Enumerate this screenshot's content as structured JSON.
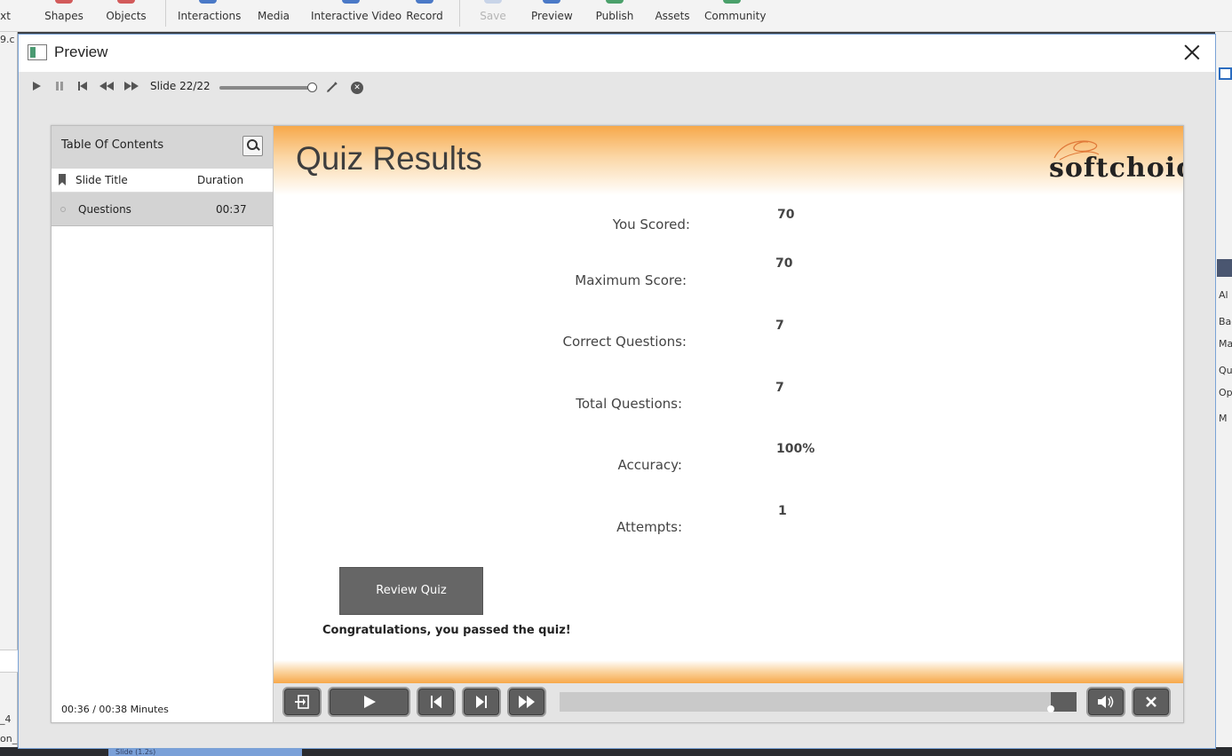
{
  "host_toolbar": {
    "items": [
      {
        "label": "xt",
        "state": "normal"
      },
      {
        "label": "Shapes",
        "state": "normal"
      },
      {
        "label": "Objects",
        "state": "normal"
      },
      {
        "label": "Interactions",
        "state": "normal"
      },
      {
        "label": "Media",
        "state": "normal"
      },
      {
        "label": "Interactive Video",
        "state": "normal"
      },
      {
        "label": "Record",
        "state": "normal"
      },
      {
        "label": "Save",
        "state": "disabled"
      },
      {
        "label": "Preview",
        "state": "normal"
      },
      {
        "label": "Publish",
        "state": "normal"
      },
      {
        "label": "Assets",
        "state": "normal"
      },
      {
        "label": "Community",
        "state": "normal"
      }
    ]
  },
  "host_edges": {
    "left_top": "9.c",
    "left_mid": "_4",
    "left_bottom": "on_",
    "right_labels": [
      "Al",
      "Back",
      "Ma",
      "Qual",
      "Op",
      "M"
    ],
    "bottom_tab": "Slide (1.2s)"
  },
  "dialog": {
    "title": "Preview",
    "controls": {
      "play_icon": "play-icon",
      "pause_icon": "pause-icon",
      "first_icon": "first-slide-icon",
      "rewind_icon": "rewind-icon",
      "forward_icon": "fast-forward-icon",
      "slide_counter": "Slide 22/22",
      "slider_progress": 1.0,
      "edit_icon": "pencil-icon",
      "stop_icon": "close-circle-icon"
    }
  },
  "toc": {
    "title": "Table Of Contents",
    "col_title": "Slide Title",
    "col_duration": "Duration",
    "rows": [
      {
        "title": "Questions",
        "duration": "00:37"
      }
    ],
    "time": "00:36 / 00:38 Minutes"
  },
  "slide": {
    "title": "Quiz Results",
    "logo": "softchoice",
    "results": [
      {
        "label": "You Scored:",
        "value": "70"
      },
      {
        "label": "Maximum Score:",
        "value": "70"
      },
      {
        "label": "Correct Questions:",
        "value": "7"
      },
      {
        "label": "Total Questions:",
        "value": "7"
      },
      {
        "label": "Accuracy:",
        "value": "100%"
      },
      {
        "label": "Attempts:",
        "value": "1"
      }
    ],
    "review_button": "Review Quiz",
    "pass_message": "Congratulations, you passed the quiz!"
  },
  "playbar": {
    "progress": 0.95,
    "colors": {
      "button": "#5e5e5e",
      "track": "#c9c9c9"
    }
  },
  "colors": {
    "accent_orange": "#f7a84a",
    "dialog_border": "#7aa3d6",
    "logo_swoosh": "#e07a3a"
  }
}
